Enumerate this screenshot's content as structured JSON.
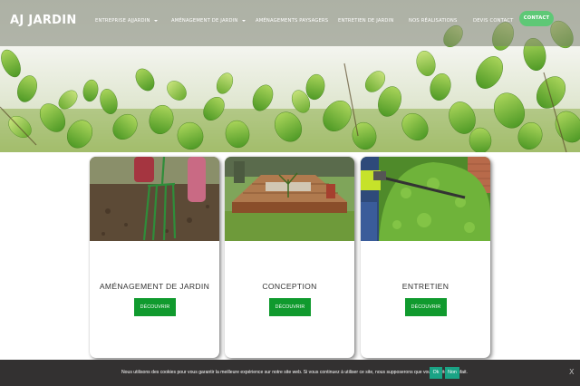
{
  "header": {
    "logo": "AJ JARDIN",
    "nav": [
      {
        "label": "ENTREPRISE AJJARDIN",
        "has_dropdown": true
      },
      {
        "label": "AMÉNAGEMENT DE JARDIN",
        "has_dropdown": true
      },
      {
        "label": "AMÉNAGEMENTS PAYSAGERS",
        "has_dropdown": false
      },
      {
        "label": "ENTRETIEN DE JARDIN",
        "has_dropdown": false
      },
      {
        "label": "NOS RÉALISATIONS",
        "has_dropdown": false
      },
      {
        "label": "DEVIS CONTACT",
        "has_dropdown": false
      }
    ],
    "contact_button": "CONTACT"
  },
  "cards": [
    {
      "title": "AMÉNAGEMENT DE JARDIN",
      "button": "DÉCOUVRIR",
      "image": "garden-fork-soil-photo"
    },
    {
      "title": "CONCEPTION",
      "button": "DÉCOUVRIR",
      "image": "wooden-deck-garden-photo"
    },
    {
      "title": "ENTRETIEN",
      "button": "DÉCOUVRIR",
      "image": "hedge-trimming-photo"
    }
  ],
  "cookie_bar": {
    "text": "Nous utilisons des cookies pour vous garantir la meilleure expérience sur notre site web. Si vous continuez à utiliser ce site, nous supposerons que vous en êtes satisfait.",
    "ok_label": "Ok",
    "no_label": "Non",
    "close_label": "X"
  },
  "colors": {
    "accent_green": "#5ec876",
    "button_green": "#109a2e",
    "cookie_bg": "#333131",
    "cookie_button": "#1aa385"
  },
  "icons": [
    "dropdown-caret-icon",
    "close-icon"
  ]
}
